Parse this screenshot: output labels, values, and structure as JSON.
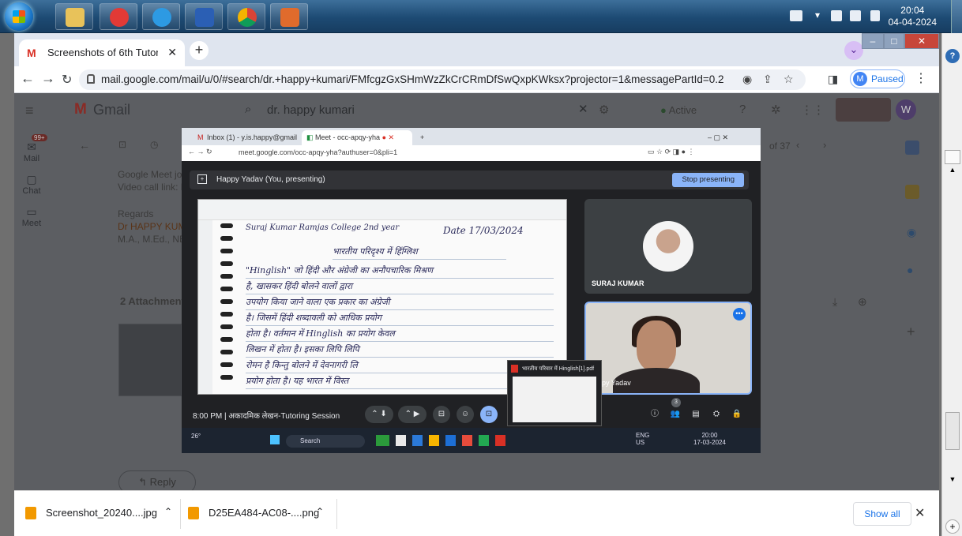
{
  "os_taskbar": {
    "clock_time": "20:04",
    "clock_date": "04-04-2024"
  },
  "browser": {
    "tab_title": "Screenshots of 6th Tutoring sessi",
    "tab_close": "✕",
    "new_tab": "+",
    "tab_search_icon": "chevron-down-icon",
    "url": "mail.google.com/mail/u/0/#search/dr.+happy+kumari/FMfcgzGxSHmWzZkCrCRmDfSwQxpKWksx?projector=1&messagePartId=0.2",
    "profile_initial": "M",
    "profile_status": "Paused",
    "window_controls": {
      "minimize": "–",
      "maximize": "□",
      "close": "✕"
    }
  },
  "gmail": {
    "product": "Gmail",
    "search_query": "dr. happy kumari",
    "status": "Active",
    "mail_badge": "99+",
    "nav": {
      "mail": "Mail",
      "chat": "Chat",
      "meet": "Meet"
    },
    "account_initial": "W",
    "counter_fragment": "of 37",
    "body_lines": [
      "Google Meet jo",
      "Video call link: h",
      "Regards",
      "Dr HAPPY KUM",
      "M.A., M.Ed., NE"
    ],
    "attachments_label": "2 Attachment",
    "reply_label": "Reply"
  },
  "meet_screenshot": {
    "tab1": "Inbox (1) - y.is.happy@gmail.cc",
    "tab2": "Meet - occ-apqy-yha",
    "url": "meet.google.com/occ-apqy-yha?authuser=0&pli=1",
    "presenting_label": "Happy Yadav (You, presenting)",
    "stop_presenting": "Stop presenting",
    "participant1": "SURAJ KUMAR",
    "participant2": "py Yadav",
    "time": "8:00 PM",
    "meeting_title": "अकादमिक लेखन-Tutoring Session",
    "pdf_popup_title": "भारतीय परिवार में Hinglish[1].pdf",
    "people_count": "3",
    "inner_taskbar": {
      "search": "Search",
      "lang": "ENG",
      "region": "US",
      "time": "20:00",
      "date": "17-03-2024",
      "weather": "26°"
    },
    "note_lines": [
      "Suraj Kumar  Ramjas College  2nd year",
      "Date 17/03/2024",
      "भारतीय परिदृश्य में हिंग्लिश",
      "\"Hinglish\" जो हिंदी और अंग्रेजी का अनौपचारिक मिश्रण",
      "है, खासकर हिंदी बोलने वालों द्वारा",
      "उपयोग किया जाने वाला एक प्रकार का अंग्रेजी",
      "है। जिसमें हिंदी शब्दावली को आधिक प्रयोग",
      "होता है। वर्तमान में Hinglish का प्रयोग केवल",
      "लिखन में होता है। इसका लिपि लिपि",
      "रोमन है किन्तु बोलने में देवनागरी लि",
      "प्रयोग होता है। यह भारत में विस्त"
    ]
  },
  "downloads": [
    {
      "name": "Screenshot_20240....jpg"
    },
    {
      "name": "D25EA484-AC08-....png"
    }
  ],
  "downloads_show_all": "Show all",
  "downloads_close": "✕"
}
